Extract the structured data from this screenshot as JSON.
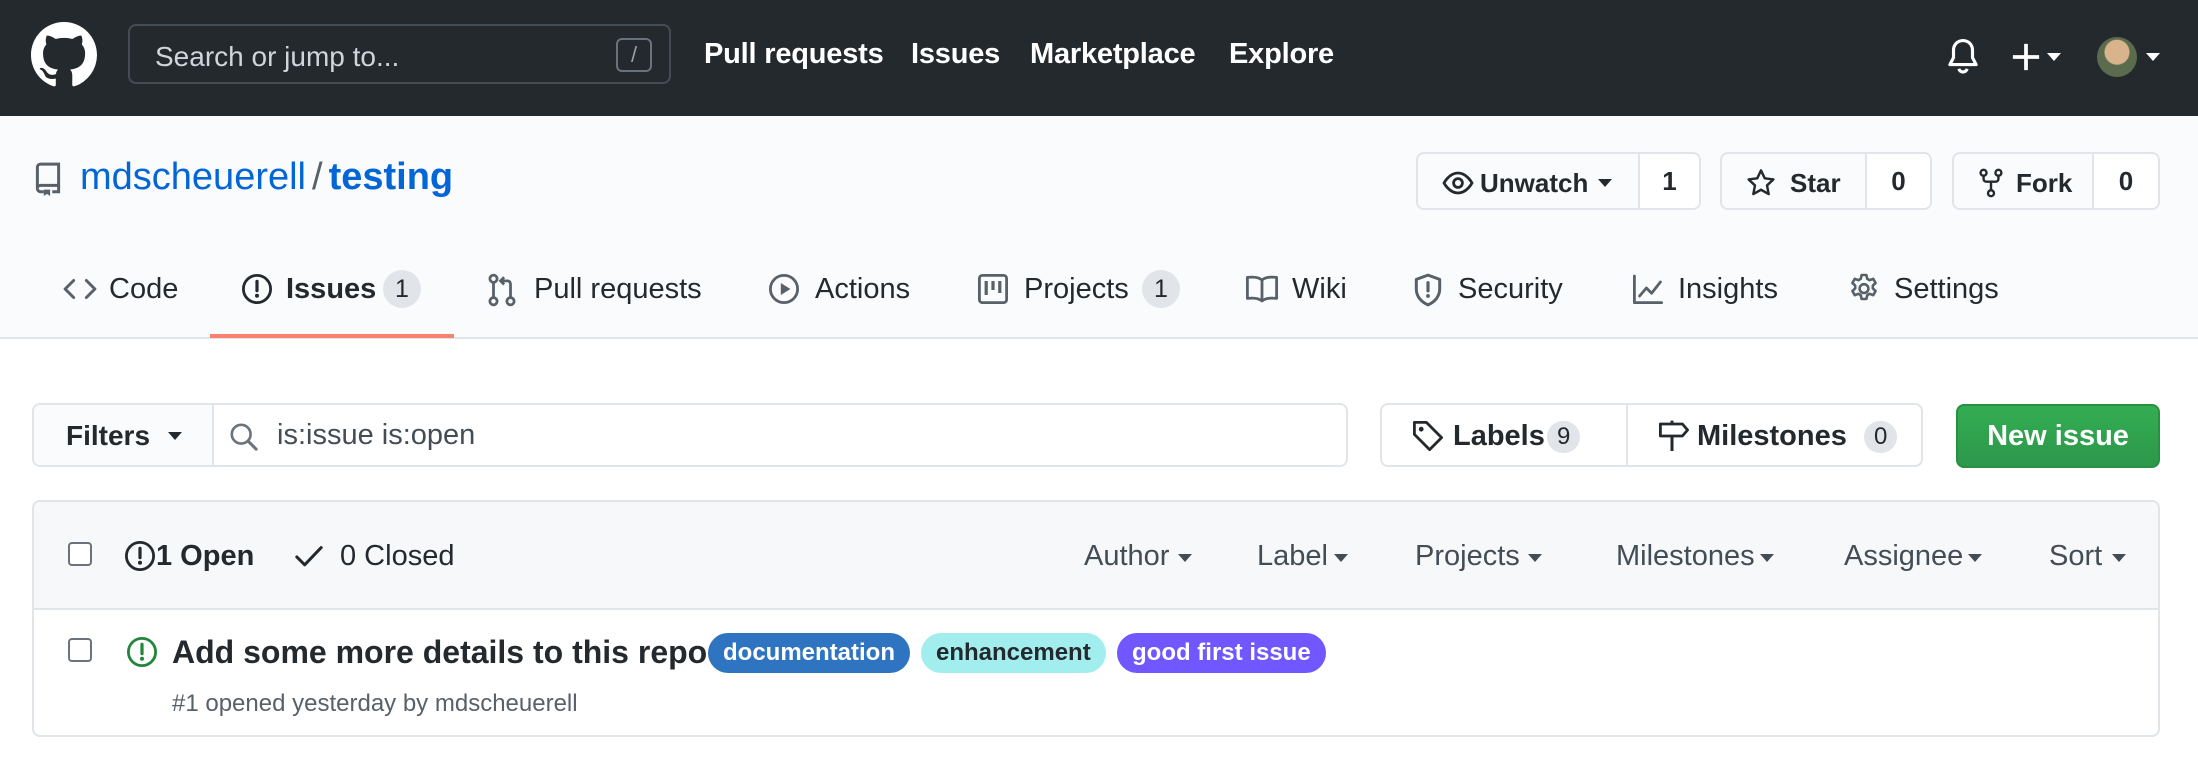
{
  "header": {
    "search_placeholder": "Search or jump to...",
    "search_shortcut": "/",
    "nav": [
      "Pull requests",
      "Issues",
      "Marketplace",
      "Explore"
    ]
  },
  "repo": {
    "owner": "mdscheuerell",
    "separator": "/",
    "name": "testing",
    "unwatch_label": "Unwatch",
    "watch_count": "1",
    "star_label": "Star",
    "star_count": "0",
    "fork_label": "Fork",
    "fork_count": "0"
  },
  "tabs": [
    {
      "label": "Code",
      "icon": "code-icon"
    },
    {
      "label": "Issues",
      "icon": "issue-opened-icon",
      "count": "1",
      "selected": true
    },
    {
      "label": "Pull requests",
      "icon": "git-pull-request-icon"
    },
    {
      "label": "Actions",
      "icon": "play-icon"
    },
    {
      "label": "Projects",
      "icon": "project-icon",
      "count": "1"
    },
    {
      "label": "Wiki",
      "icon": "book-icon"
    },
    {
      "label": "Security",
      "icon": "shield-icon"
    },
    {
      "label": "Insights",
      "icon": "graph-icon"
    },
    {
      "label": "Settings",
      "icon": "gear-icon"
    }
  ],
  "toolbar": {
    "filters_label": "Filters",
    "query": "is:issue is:open",
    "labels_label": "Labels",
    "labels_count": "9",
    "milestones_label": "Milestones",
    "milestones_count": "0",
    "new_issue_label": "New issue"
  },
  "list_header": {
    "open_label": "1 Open",
    "closed_label": "0 Closed",
    "menus": [
      "Author",
      "Label",
      "Projects",
      "Milestones",
      "Assignee",
      "Sort"
    ]
  },
  "issues": [
    {
      "title": "Add some more details to this repo",
      "labels": [
        {
          "name": "documentation",
          "color": "#2f74c0",
          "text_color": "#ffffff"
        },
        {
          "name": "enhancement",
          "color": "#a2eeef",
          "text_color": "#24292e"
        },
        {
          "name": "good first issue",
          "color": "#7057ff",
          "text_color": "#ffffff"
        }
      ],
      "meta": "#1 opened yesterday by mdscheuerell"
    }
  ],
  "colors": {
    "header_bg": "#24292e",
    "link_blue": "#0366d6",
    "tab_underline": "#f9826c",
    "new_issue_green": "#2ea44f",
    "open_icon_green": "#22863a"
  }
}
